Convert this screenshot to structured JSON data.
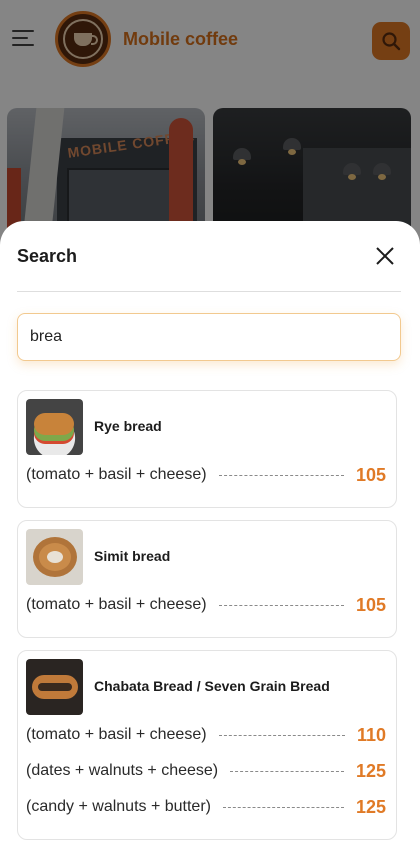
{
  "header": {
    "brand": "Mobile coffee",
    "logo_text": "MOBILE COFFEE",
    "menu_icon": "hamburger-icon",
    "search_icon": "search-icon"
  },
  "photos": {
    "storefront_sign": "MOBILE COFFEE"
  },
  "sheet": {
    "title": "Search",
    "close_icon": "close-icon",
    "search": {
      "value": "brea",
      "placeholder": ""
    }
  },
  "results": [
    {
      "name": "Rye bread",
      "thumb_icon": "sandwich-image",
      "options": [
        {
          "desc": "(tomato + basil + cheese)",
          "price": "105"
        }
      ]
    },
    {
      "name": "Simit bread",
      "thumb_icon": "bagel-image",
      "options": [
        {
          "desc": "(tomato + basil + cheese)",
          "price": "105"
        }
      ]
    },
    {
      "name": "Chabata Bread / Seven Grain Bread",
      "thumb_icon": "ciabatta-image",
      "options": [
        {
          "desc": "(tomato + basil + cheese)",
          "price": "110"
        },
        {
          "desc": "(dates + walnuts + cheese)",
          "price": "125"
        },
        {
          "desc": "(candy + walnuts + butter)",
          "price": "125"
        }
      ]
    }
  ],
  "colors": {
    "accent": "#e07a26",
    "overlay": "rgba(0,0,0,0.48)"
  }
}
